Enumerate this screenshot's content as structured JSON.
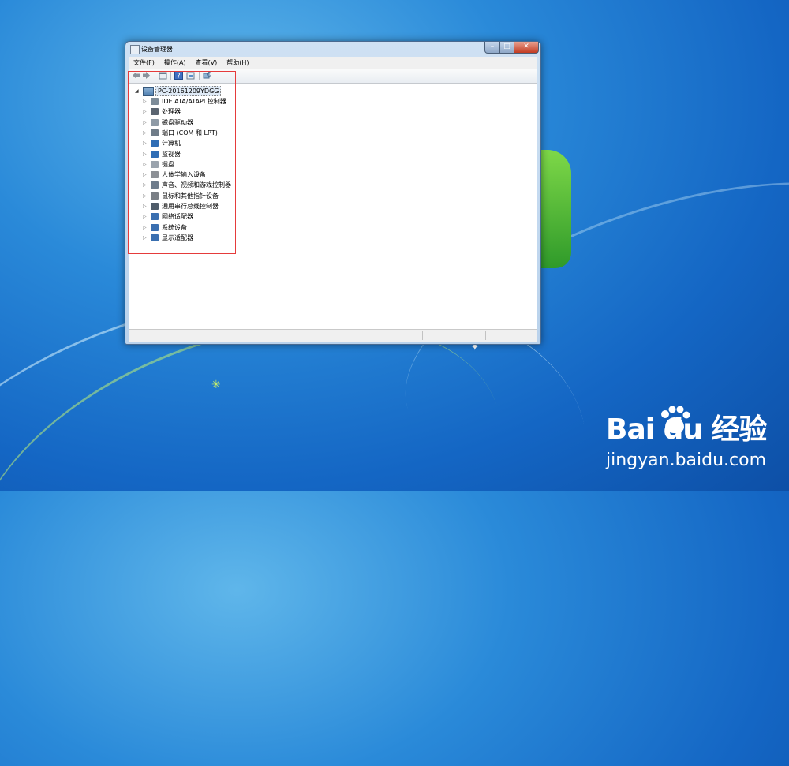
{
  "window": {
    "title": "设备管理器"
  },
  "menu": [
    {
      "label": "文件(F)"
    },
    {
      "label": "操作(A)"
    },
    {
      "label": "查看(V)"
    },
    {
      "label": "帮助(H)"
    }
  ],
  "toolbar": {
    "icons": [
      "back-arrow-icon",
      "forward-arrow-icon",
      "properties-icon",
      "help-icon",
      "show-hide-icon",
      "scan-hardware-icon"
    ]
  },
  "tree": {
    "root": "PC-20161209YDGG",
    "items": [
      {
        "label": "IDE ATA/ATAPI 控制器",
        "color": "#7d8c99"
      },
      {
        "label": "处理器",
        "color": "#5a6470"
      },
      {
        "label": "磁盘驱动器",
        "color": "#8e9aa6"
      },
      {
        "label": "端口 (COM 和 LPT)",
        "color": "#6f7c88"
      },
      {
        "label": "计算机",
        "color": "#2f6db5"
      },
      {
        "label": "监视器",
        "color": "#2f6db5"
      },
      {
        "label": "键盘",
        "color": "#9aa3ad"
      },
      {
        "label": "人体学输入设备",
        "color": "#8c9096"
      },
      {
        "label": "声音、视频和游戏控制器",
        "color": "#6e7c8c"
      },
      {
        "label": "鼠标和其他指针设备",
        "color": "#7a7f86"
      },
      {
        "label": "通用串行总线控制器",
        "color": "#4f5c6a"
      },
      {
        "label": "网络适配器",
        "color": "#3a6fb0"
      },
      {
        "label": "系统设备",
        "color": "#3a6fb0"
      },
      {
        "label": "显示适配器",
        "color": "#3a6fb0"
      }
    ]
  },
  "watermark": {
    "name": "Bai du 经验",
    "url": "jingyan.baidu.com"
  }
}
